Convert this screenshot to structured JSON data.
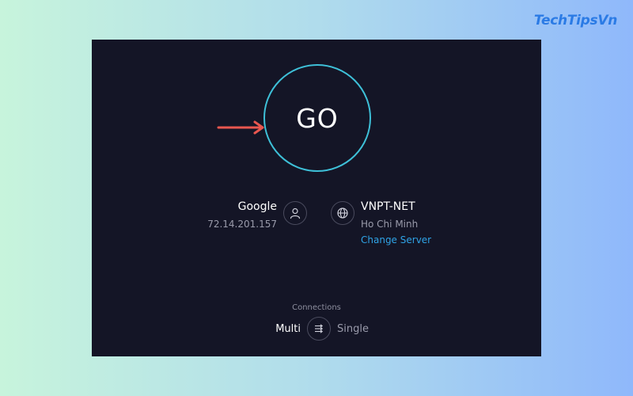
{
  "brand": {
    "text": "TechTipsVn"
  },
  "speedtest": {
    "go_label": "GO",
    "provider": {
      "name": "Google",
      "ip": "72.14.201.157"
    },
    "server": {
      "name": "VNPT-NET",
      "location": "Ho Chi Minh",
      "change_label": "Change Server"
    },
    "connections": {
      "label": "Connections",
      "multi": "Multi",
      "single": "Single",
      "selected": "Multi"
    }
  },
  "icons": {
    "user": "user-icon",
    "globe": "globe-icon",
    "connections": "connections-toggle-icon",
    "annotation": "arrow-icon"
  },
  "colors": {
    "panel_bg": "#141526",
    "go_ring": "#3ec0d8",
    "link": "#2fa3e6",
    "arrow": "#e9564f",
    "brand": "#2b7be5"
  }
}
